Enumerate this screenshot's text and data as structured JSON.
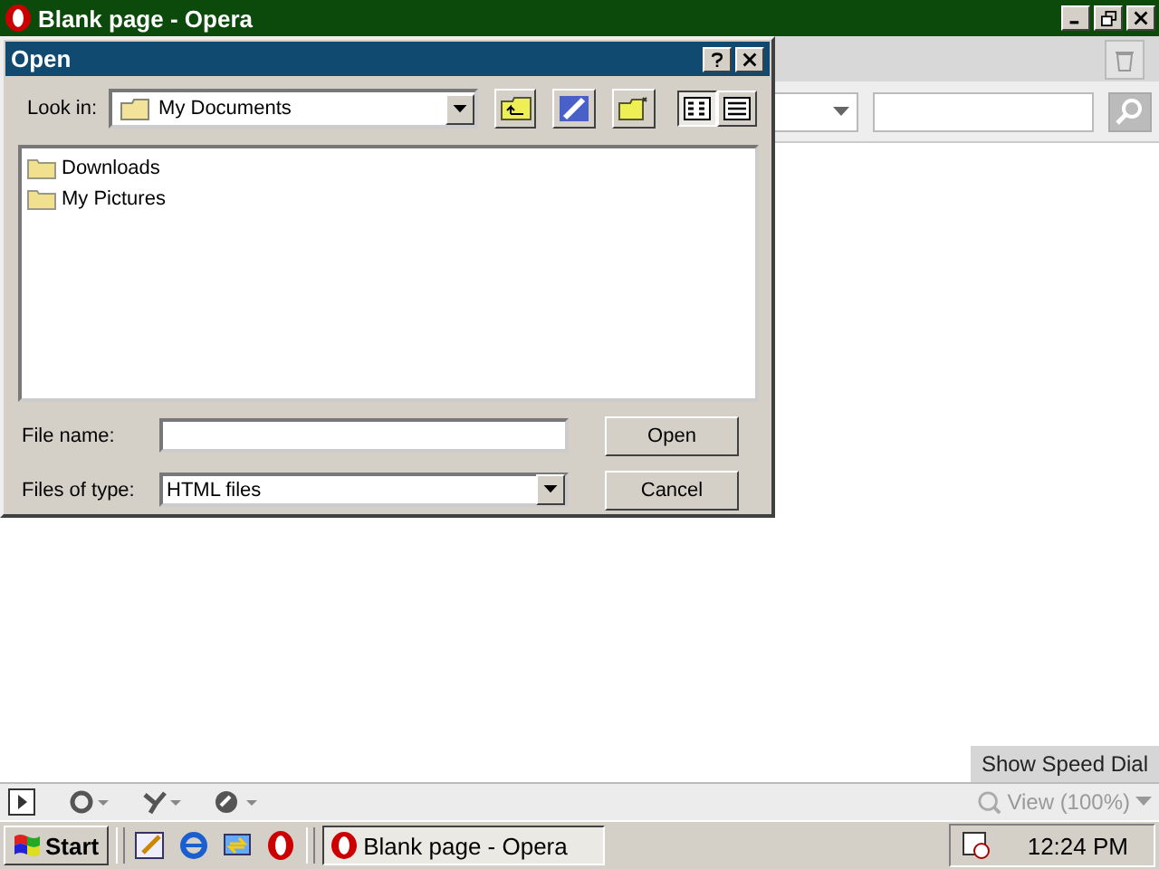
{
  "window": {
    "title": "Blank page - Opera"
  },
  "dialog": {
    "title": "Open",
    "look_in": {
      "label": "Look in:",
      "value": "My Documents"
    },
    "views": [
      {
        "selected": true
      },
      {
        "selected": false
      }
    ],
    "files": [
      {
        "name": "Downloads"
      },
      {
        "name": "My Pictures"
      }
    ],
    "file_name": {
      "label": "File name:"
    },
    "file_type": {
      "label": "Files of type:",
      "value": "HTML files"
    },
    "buttons": [
      "Open",
      "Cancel"
    ]
  },
  "speed_dial": "Show Speed Dial",
  "zoom": "View (100%)",
  "taskbar": {
    "start": "Start",
    "tasks": [
      {
        "label": "Blank page - Opera",
        "selected": true
      }
    ],
    "clock": "12:24 PM"
  }
}
